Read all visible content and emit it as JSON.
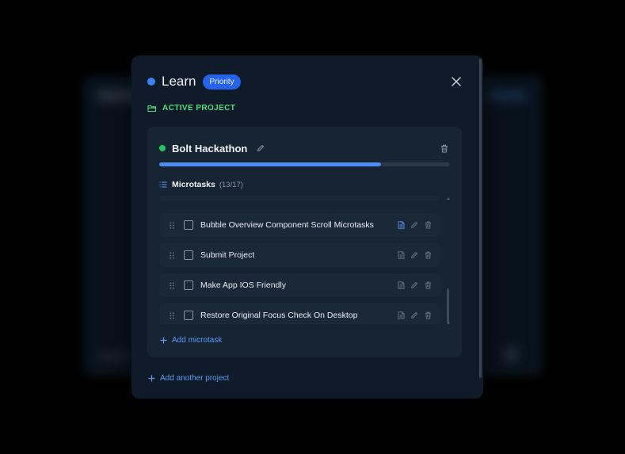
{
  "header": {
    "title": "Learn",
    "badge": "Priority",
    "accent_color": "#3b82f6"
  },
  "section": {
    "label": "ACTIVE PROJECT",
    "label_color": "#4ade80"
  },
  "project": {
    "name": "Bolt Hackathon",
    "status_color": "#22c55e",
    "progress_fraction": 0.764
  },
  "microtasks": {
    "label": "Microtasks",
    "count": "(13/17)",
    "items": [
      {
        "label": "Bubble Overview Component Scroll Microtasks",
        "has_note": true
      },
      {
        "label": "Submit Project",
        "has_note": false
      },
      {
        "label": "Make App IOS Friendly",
        "has_note": false
      },
      {
        "label": "Restore Original Focus Check On Desktop",
        "has_note": false
      }
    ],
    "add_label": "Add microtask"
  },
  "footer": {
    "add_project_label": "Add another project"
  },
  "icons": {
    "close": "close-icon",
    "folder": "folder-open-icon",
    "edit": "pencil-icon",
    "delete": "trash-icon",
    "list": "list-icon",
    "drag": "drag-handle-icon",
    "note": "note-icon",
    "add": "plus-icon"
  }
}
